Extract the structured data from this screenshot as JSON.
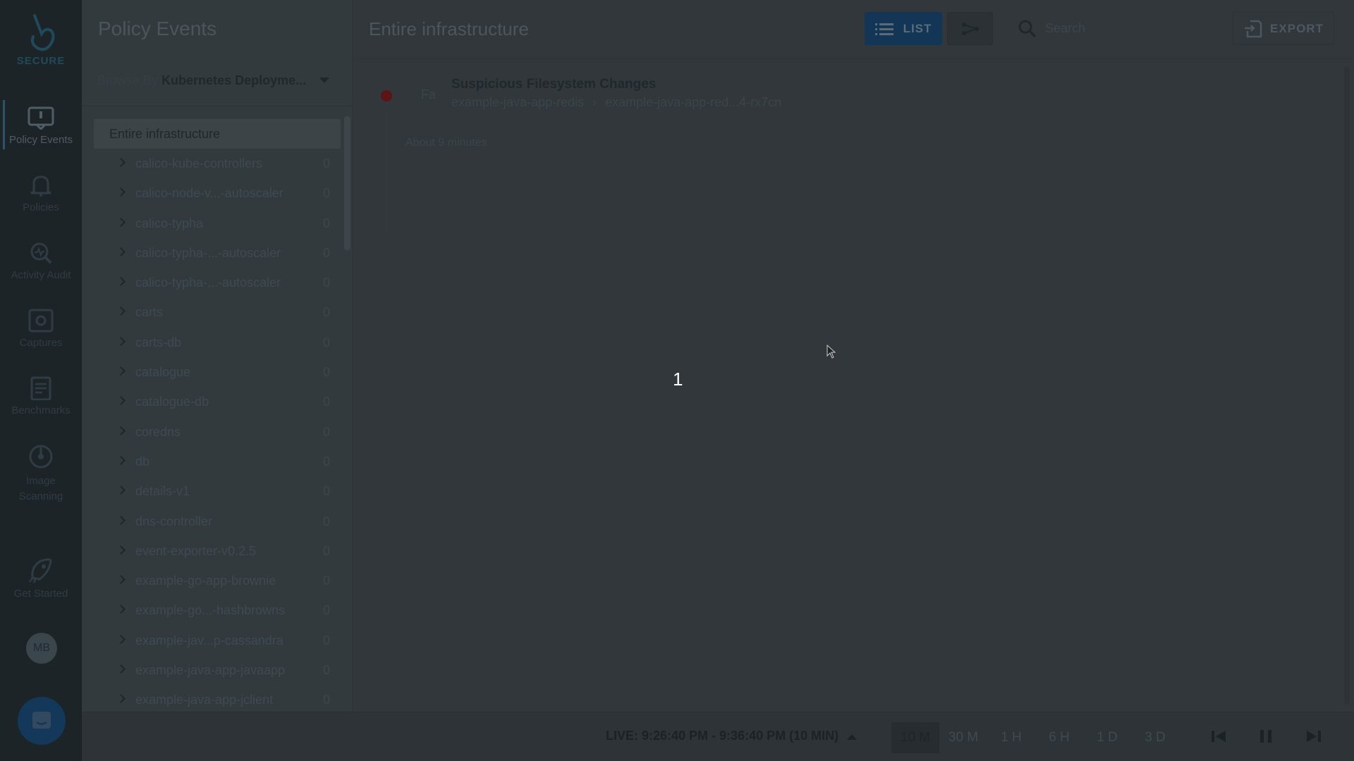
{
  "nav": {
    "logo_text": "SECURE",
    "items": [
      {
        "label": "Policy Events",
        "icon": "policy-events-icon"
      },
      {
        "label": "Policies",
        "icon": "bell-icon"
      },
      {
        "label": "Activity Audit",
        "icon": "search-activity-icon"
      },
      {
        "label": "Captures",
        "icon": "capture-icon"
      },
      {
        "label": "Benchmarks",
        "icon": "clipboard-icon"
      },
      {
        "label": "Image Scanning",
        "icon": "scan-icon"
      },
      {
        "label": "Get Started",
        "icon": "rocket-icon"
      }
    ],
    "avatar": "MB"
  },
  "panel": {
    "title": "Policy Events",
    "browse_prefix": "Browse By",
    "browse_value": "Kubernetes Deployme...",
    "root": "Entire infrastructure",
    "items": [
      {
        "label": "calico-kube-controllers",
        "count": "0"
      },
      {
        "label": "calico-node-v...-autoscaler",
        "count": "0"
      },
      {
        "label": "calico-typha",
        "count": "0"
      },
      {
        "label": "calico-typha-...-autoscaler",
        "count": "0"
      },
      {
        "label": "calico-typha-...-autoscaler",
        "count": "0"
      },
      {
        "label": "carts",
        "count": "0"
      },
      {
        "label": "carts-db",
        "count": "0"
      },
      {
        "label": "catalogue",
        "count": "0"
      },
      {
        "label": "catalogue-db",
        "count": "0"
      },
      {
        "label": "coredns",
        "count": "0"
      },
      {
        "label": "db",
        "count": "0"
      },
      {
        "label": "details-v1",
        "count": "0"
      },
      {
        "label": "dns-controller",
        "count": "0"
      },
      {
        "label": "event-exporter-v0.2.5",
        "count": "0"
      },
      {
        "label": "example-go-app-brownie",
        "count": "0"
      },
      {
        "label": "example-go...-hashbrowns",
        "count": "0"
      },
      {
        "label": "example-jav...p-cassandra",
        "count": "0"
      },
      {
        "label": "example-java-app-javaapp",
        "count": "0"
      },
      {
        "label": "example-java-app-jclient",
        "count": "0"
      }
    ]
  },
  "topbar": {
    "title": "Entire infrastructure",
    "list_label": "LIST",
    "search_placeholder": "Search",
    "export_label": "EXPORT"
  },
  "event": {
    "abbr": "Fa",
    "title": "Suspicious Filesystem Changes",
    "path_from": "example-java-app-redis",
    "path_to": "example-java-app-red...4-rx7cn",
    "time": "About 9 minutes",
    "severity_color": "#5d1414"
  },
  "overlay_number": "1",
  "bottombar": {
    "live": "LIVE: 9:26:40 PM - 9:36:40 PM (10 MIN)",
    "ranges": [
      "10 M",
      "30 M",
      "1 H",
      "6 H",
      "1 D",
      "3 D"
    ],
    "active_range": "10 M"
  }
}
